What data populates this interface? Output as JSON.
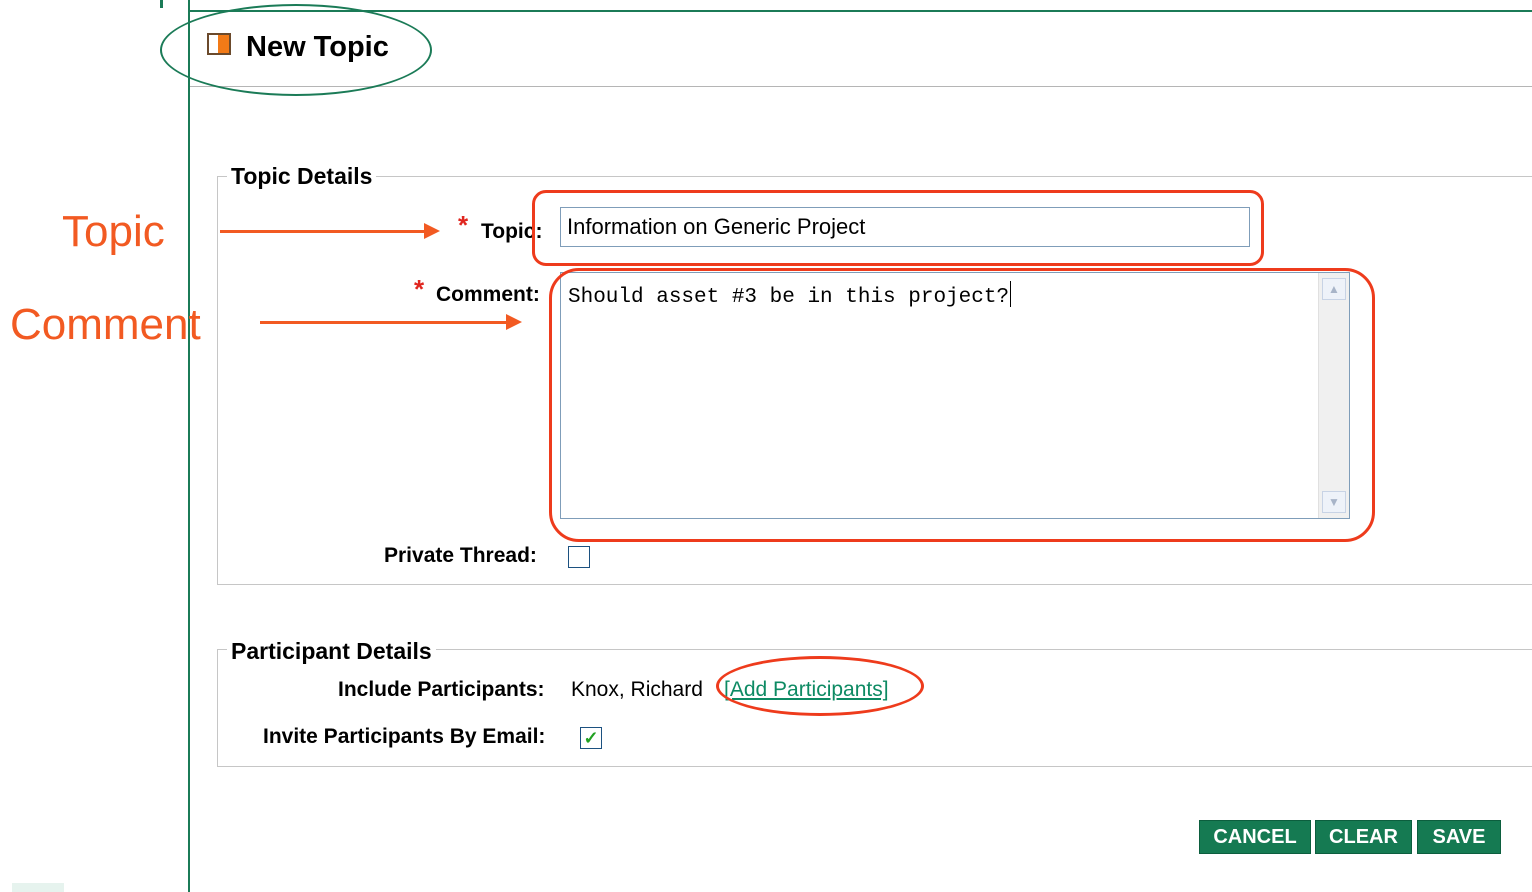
{
  "header": {
    "title": "New Topic"
  },
  "topic_details": {
    "legend": "Topic Details",
    "required_marker": "*",
    "topic_label": "Topic:",
    "topic_value": "Information on Generic Project",
    "comment_label": "Comment:",
    "comment_value": "Should asset #3 be in this project?",
    "private_label": "Private Thread:",
    "private_checked": false
  },
  "participant_details": {
    "legend": "Participant Details",
    "include_label": "Include Participants:",
    "include_value": "Knox, Richard",
    "add_link": "[Add Participants]",
    "invite_label": "Invite Participants By Email:",
    "invite_checked": true,
    "invite_mark": "✓"
  },
  "buttons": {
    "cancel": "CANCEL",
    "clear": "CLEAR",
    "save": "SAVE"
  },
  "annotations": {
    "topic_callout": "Topic",
    "comment_callout": "Comment"
  },
  "colors": {
    "frame": "#1b7b57",
    "button_bg": "#157a52",
    "link": "#0d8a63",
    "required": "#e0261f",
    "annotation": "#f25a22",
    "annotation_circle": "#1b7b57"
  },
  "icons": {
    "title_icon": "half-filled-orange-square-icon"
  }
}
